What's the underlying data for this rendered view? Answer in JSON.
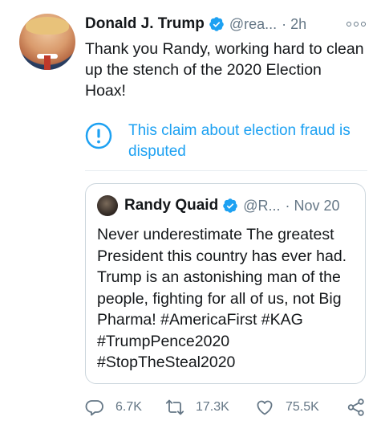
{
  "tweet": {
    "author_name": "Donald J. Trump",
    "handle": "@rea...",
    "time": "· 2h",
    "text": "Thank you Randy, working hard to clean up the stench of the 2020 Election Hoax!",
    "notice": "This claim about election fraud is disputed"
  },
  "quoted": {
    "author_name": "Randy Quaid",
    "handle": "@R...",
    "time": "· Nov 20",
    "text": "Never underestimate The greatest President this country has ever had. Trump is an astonishing man of the people, fighting for all of us, not Big Pharma! #AmericaFirst #KAG #TrumpPence2020 #StopTheSteal2020"
  },
  "actions": {
    "replies": "6.7K",
    "retweets": "17.3K",
    "likes": "75.5K"
  },
  "colors": {
    "accent": "#1da1f2",
    "secondary_text": "#657786",
    "primary_text": "#14171a",
    "border": "#ccd6dd"
  },
  "icons": [
    "verified-badge-icon",
    "more-options-icon",
    "info-icon",
    "reply-icon",
    "retweet-icon",
    "like-icon",
    "share-icon"
  ]
}
